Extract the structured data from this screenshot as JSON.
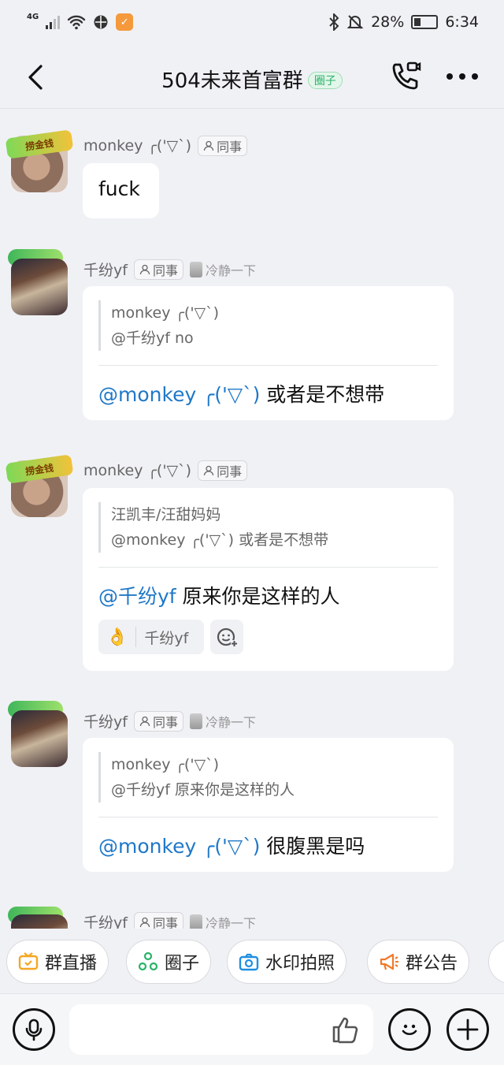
{
  "status_bar": {
    "network": "4G",
    "battery": "28%",
    "time": "6:34"
  },
  "header": {
    "title": "504未来首富群",
    "tag": "圈子"
  },
  "messages": [
    {
      "sender": "monkey ╭('▽`)",
      "role": "同事",
      "text": "fuck",
      "avatar_badge": "捞金钱"
    },
    {
      "sender": "千纷yf",
      "role": "同事",
      "status": "冷静一下",
      "quote_author": "monkey ╭('▽`)",
      "quote_text": "@千纷yf no",
      "mention": "@monkey ╭('▽`)",
      "text": " 或者是不想带"
    },
    {
      "sender": "monkey ╭('▽`)",
      "role": "同事",
      "avatar_badge": "捞金钱",
      "quote_author": "汪凯丰/汪甜妈妈",
      "quote_text": "@monkey ╭('▽`) 或者是不想带",
      "mention": "@千纷yf",
      "text": " 原来你是这样的人",
      "reaction_user": "千纷yf"
    },
    {
      "sender": "千纷yf",
      "role": "同事",
      "status": "冷静一下",
      "quote_author": "monkey ╭('▽`)",
      "quote_text": "@千纷yf 原来你是这样的人",
      "mention": "@monkey ╭('▽`)",
      "text": " 很腹黑是吗"
    },
    {
      "sender": "千纷yf",
      "role": "同事",
      "status": "冷静一下"
    }
  ],
  "tools": [
    {
      "label": "群直播",
      "icon": "tv-icon",
      "color": "#f5a623"
    },
    {
      "label": "圈子",
      "icon": "circle-group-icon",
      "color": "#2bb36a"
    },
    {
      "label": "水印拍照",
      "icon": "camera-icon",
      "color": "#1f8fe0"
    },
    {
      "label": "群公告",
      "icon": "megaphone-icon",
      "color": "#f07a2a"
    }
  ],
  "colors": {
    "accent": "#1f78c8",
    "background": "#f0f1f5"
  }
}
